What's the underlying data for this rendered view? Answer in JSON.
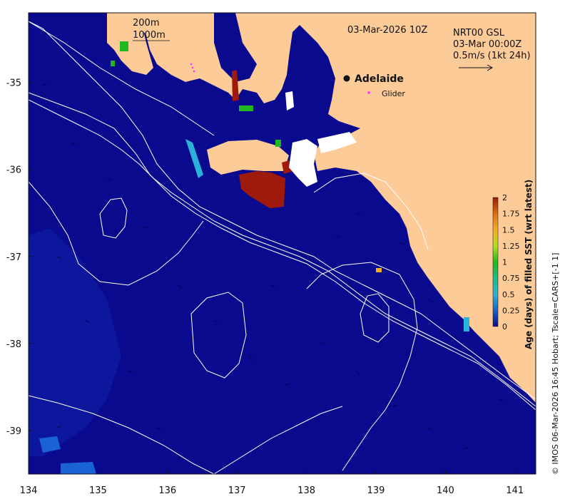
{
  "map": {
    "title": "03-Mar-2026 10Z",
    "depth_labels": [
      "200m",
      "1000m"
    ],
    "current_info": [
      "NRT00 GSL",
      "03-Mar 00:00Z",
      "0.5m/s (1kt 24h)"
    ],
    "city": "Adelaide",
    "glider_label": "Glider",
    "credit": "© IMOS 06-Mar-2026 16:45 Hobart; Tscale=CARS+[-1 1]",
    "colors": {
      "ocean": "#0a0a8f",
      "land": "#fdcb98",
      "contour": "#ffffff",
      "stale": "#9e1a0c",
      "glider": "#ff33ff"
    }
  },
  "chart_data": {
    "type": "heatmap",
    "x_ticks": [
      134,
      135,
      136,
      137,
      138,
      139,
      140,
      141
    ],
    "y_ticks": [
      -35,
      -36,
      -37,
      -38,
      -39
    ],
    "x_range": [
      134,
      141.3
    ],
    "y_range": [
      -39.5,
      -34.2
    ],
    "colorbar": {
      "title": "Age (days) of filled SST (wrt latest)",
      "ticks": [
        "2",
        "1.75",
        "1.5",
        "1.25",
        "1",
        "0.75",
        "0.5",
        "0.25",
        "0"
      ],
      "range": [
        0,
        2
      ],
      "colors": [
        "#0a0a8f",
        "#1560d0",
        "#29b3d8",
        "#17c08a",
        "#1fb81f",
        "#b0e020",
        "#f0b020",
        "#e07010",
        "#9e1a0c"
      ]
    },
    "city_location": {
      "lon": 138.6,
      "lat": -34.93
    },
    "glider_location": {
      "lon": 138.88,
      "lat": -35.1
    }
  }
}
